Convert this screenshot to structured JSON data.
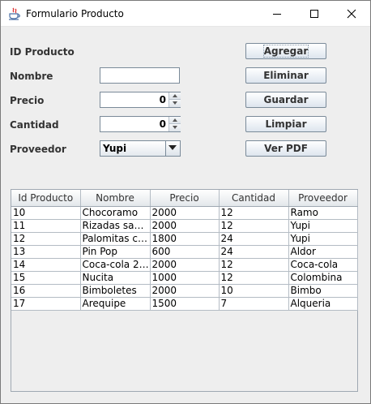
{
  "window": {
    "title": "Formulario Producto"
  },
  "form": {
    "id_label": "ID Producto",
    "nombre_label": "Nombre",
    "nombre_value": "",
    "precio_label": "Precio",
    "precio_value": "0",
    "cantidad_label": "Cantidad",
    "cantidad_value": "0",
    "proveedor_label": "Proveedor",
    "proveedor_value": "Yupi"
  },
  "buttons": {
    "agregar": "Agregar",
    "eliminar": "Eliminar",
    "guardar": "Guardar",
    "limpiar": "Limpiar",
    "ver_pdf": "Ver PDF"
  },
  "table": {
    "columns": [
      "Id Producto",
      "Nombre",
      "Precio",
      "Cantidad",
      "Proveedor"
    ],
    "rows": [
      [
        "10",
        "Chocoramo",
        "2000",
        "12",
        "Ramo"
      ],
      [
        "11",
        "Rizadas sab...",
        "2000",
        "12",
        "Yupi"
      ],
      [
        "12",
        "Palomitas ca...",
        "1800",
        "24",
        "Yupi"
      ],
      [
        "13",
        "Pin Pop",
        "600",
        "24",
        "Aldor"
      ],
      [
        "14",
        "Coca-cola 25...",
        "2000",
        "12",
        "Coca-cola"
      ],
      [
        "15",
        "Nucita",
        "1000",
        "12",
        "Colombina"
      ],
      [
        "16",
        "Bimboletes",
        "2000",
        "10",
        "Bimbo"
      ],
      [
        "17",
        "Arequipe",
        "1500",
        "7",
        "Alqueria"
      ]
    ]
  },
  "icons": {
    "app": "java-cup-icon",
    "minimize": "minimize-icon",
    "maximize": "maximize-icon",
    "close": "close-icon"
  }
}
